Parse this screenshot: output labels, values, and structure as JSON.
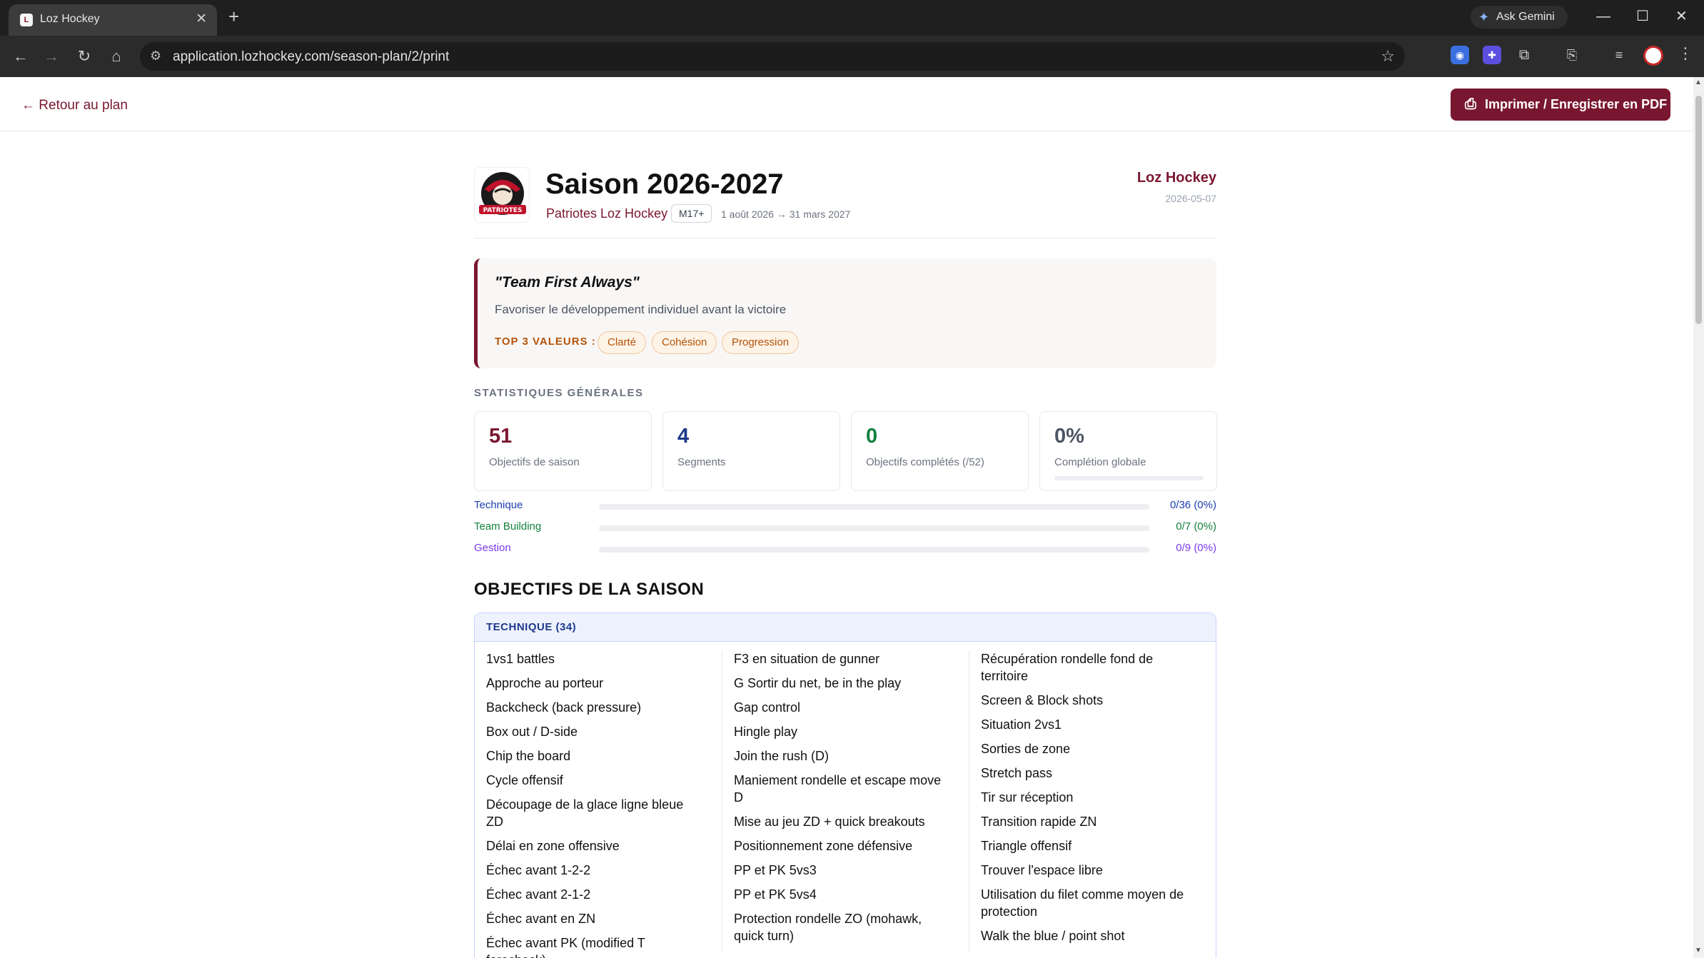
{
  "browser": {
    "tab_title": "Loz Hockey",
    "favicon_letter": "L",
    "ask_gemini": "Ask Gemini",
    "url": "application.lozhockey.com/season-plan/2/print"
  },
  "header": {
    "back_link": "← Retour au plan",
    "print_button": "Imprimer / Enregistrer en PDF"
  },
  "season": {
    "title": "Saison 2026-2027",
    "team": "Patriotes Loz Hockey",
    "level": "M17+",
    "dates": "1 août 2026 → 31 mars 2027",
    "organization": "Loz Hockey",
    "print_date": "2026-05-07",
    "logo_text": "PATRIOTES"
  },
  "vision": {
    "motto": "\"Team First Always\"",
    "statement": "Favoriser le développement individuel avant la victoire",
    "values_label": "TOP 3 VALEURS :",
    "values": [
      "Clarté",
      "Cohésion",
      "Progression"
    ]
  },
  "stats": {
    "section_label": "STATISTIQUES GÉNÉRALES",
    "cards": [
      {
        "value": "51",
        "label": "Objectifs de saison",
        "color": "#7a1730"
      },
      {
        "value": "4",
        "label": "Segments",
        "color": "#1e3a8a"
      },
      {
        "value": "0",
        "label": "Objectifs complétés (/52)",
        "color": "#15803d"
      },
      {
        "value": "0%",
        "label": "Complétion globale",
        "color": "#4b5563"
      }
    ],
    "progress": [
      {
        "name": "Technique",
        "count": "0/36 (0%)",
        "fraction": 0,
        "color": "#1e40af"
      },
      {
        "name": "Team Building",
        "count": "0/7 (0%)",
        "fraction": 0,
        "color": "#15803d"
      },
      {
        "name": "Gestion",
        "count": "0/9 (0%)",
        "fraction": 0,
        "color": "#7c3aed"
      }
    ]
  },
  "objectives": {
    "heading": "OBJECTIFS DE LA SAISON",
    "group_title": "TECHNIQUE (34)",
    "columns": [
      [
        "1vs1 battles",
        "Approche au porteur",
        "Backcheck (back pressure)",
        "Box out / D-side",
        "Chip the board",
        "Cycle offensif",
        "Découpage de la glace ligne bleue ZD",
        "Délai en zone offensive",
        "Échec avant 1-2-2",
        "Échec avant 2-1-2",
        "Échec avant en ZN",
        "Échec avant PK (modified T forecheck)"
      ],
      [
        "F3 en situation de gunner",
        "G Sortir du net, be in the play",
        "Gap control",
        "Hingle play",
        "Join the rush (D)",
        "Maniement rondelle et escape move D",
        "Mise au jeu ZD + quick breakouts",
        "Positionnement zone défensive",
        "PP et PK 5vs3",
        "PP et PK 5vs4",
        "Protection rondelle ZO (mohawk, quick turn)"
      ],
      [
        "Récupération rondelle fond de territoire",
        "Screen & Block shots",
        "Situation 2vs1",
        "Sorties de zone",
        "Stretch pass",
        "Tir sur réception",
        "Transition rapide ZN",
        "Triangle offensif",
        "Trouver l'espace libre",
        "Utilisation du filet comme moyen de protection",
        "Walk the blue / point shot"
      ]
    ]
  }
}
